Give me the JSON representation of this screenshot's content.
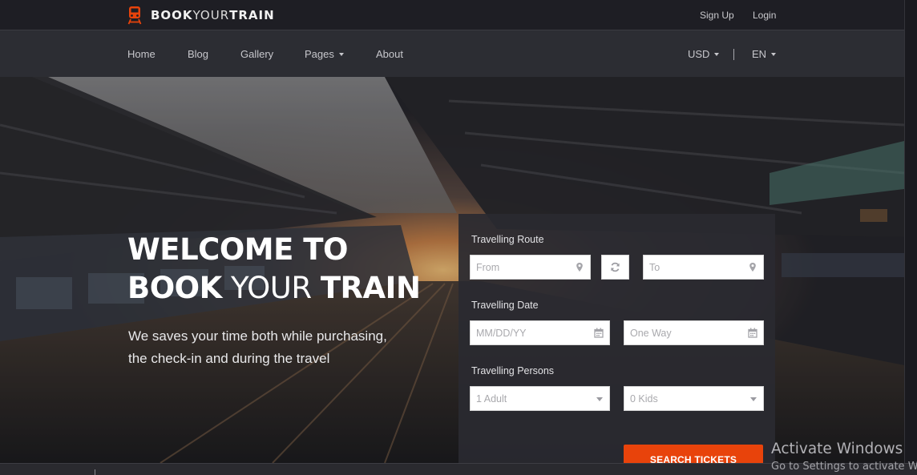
{
  "brand": {
    "part1": "BOOK",
    "part2": "YOUR",
    "part3": "TRAIN",
    "icon": "train-icon",
    "accent": "#e8430b"
  },
  "top_links": {
    "signup": "Sign Up",
    "login": "Login"
  },
  "nav": {
    "items": [
      "Home",
      "Blog",
      "Gallery",
      "Pages",
      "About"
    ],
    "currency": "USD",
    "separator": "|",
    "language": "EN"
  },
  "hero": {
    "line1": "WELCOME TO",
    "line2_bold": "BOOK",
    "line2_light": "YOUR",
    "line2_bold2": "TRAIN",
    "subtitle_line1": "We saves your time both while purchasing,",
    "subtitle_line2": "the check-in and during the travel"
  },
  "booking": {
    "route_label": "Travelling Route",
    "from_placeholder": "From",
    "to_placeholder": "To",
    "date_label": "Travelling Date",
    "date_placeholder": "MM/DD/YY",
    "trip_type": "One Way",
    "persons_label": "Travelling Persons",
    "adults": "1 Adult",
    "kids": "0 Kids",
    "search_label": "SEARCH TICKETS"
  },
  "watermark": {
    "title": "Activate Windows",
    "subtitle": "Go to Settings to activate Windows."
  }
}
